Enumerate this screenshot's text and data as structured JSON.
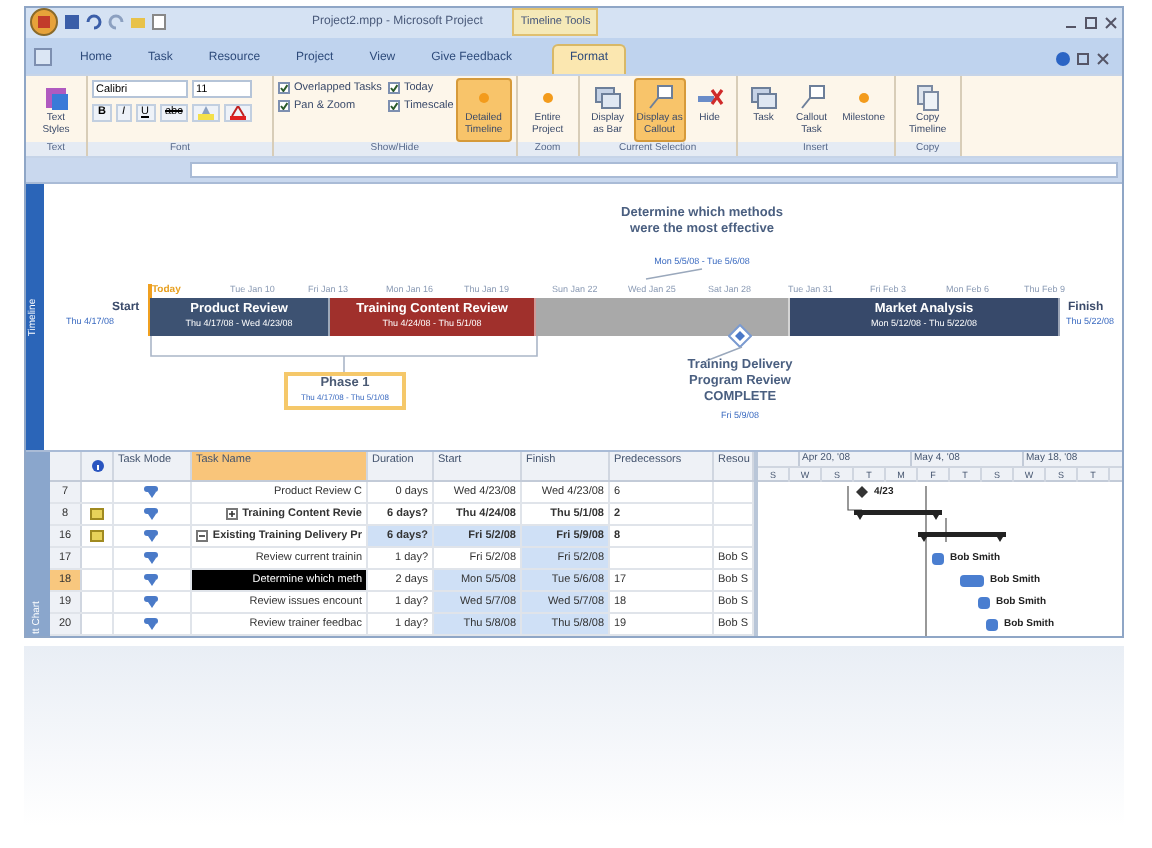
{
  "window": {
    "title": "Project2.mpp - Microsoft Project",
    "contextual_tab": "Timeline Tools"
  },
  "tabs": [
    {
      "label": "Home",
      "selected": false
    },
    {
      "label": "Task",
      "selected": false
    },
    {
      "label": "Resource",
      "selected": false
    },
    {
      "label": "Project",
      "selected": false
    },
    {
      "label": "View",
      "selected": false
    },
    {
      "label": "Give Feedback",
      "selected": false
    },
    {
      "label": "Format",
      "selected": true
    }
  ],
  "ribbon": [
    {
      "label": "Text",
      "items": [
        {
          "kind": "big",
          "label": "Text Styles",
          "selected": false
        }
      ]
    },
    {
      "label": "Font",
      "items": [
        {
          "kind": "font",
          "font": "Calibri",
          "size": "11",
          "styles": [
            "B",
            "I",
            "U",
            "abc"
          ]
        }
      ]
    },
    {
      "label": "Show/Hide",
      "items": [
        {
          "kind": "checks",
          "checks": [
            {
              "label": "Overlapped Tasks",
              "checked": true
            },
            {
              "label": "Today",
              "checked": true
            },
            {
              "label": "Pan & Zoom",
              "checked": true
            },
            {
              "label": "Timescale",
              "checked": true
            }
          ]
        },
        {
          "kind": "big",
          "label": "Detailed Timeline",
          "selected": true
        }
      ]
    },
    {
      "label": "Zoom",
      "items": [
        {
          "kind": "big",
          "label": "Entire Project",
          "selected": false
        }
      ]
    },
    {
      "label": "Current Selection",
      "items": [
        {
          "kind": "big",
          "label": "Display as Bar",
          "selected": false
        },
        {
          "kind": "big",
          "label": "Display as Callout",
          "selected": true
        },
        {
          "kind": "big",
          "label": "Hide",
          "selected": false
        }
      ]
    },
    {
      "label": "Insert",
      "items": [
        {
          "kind": "big",
          "label": "Task",
          "selected": false
        },
        {
          "kind": "big",
          "label": "Callout Task",
          "selected": false
        },
        {
          "kind": "big",
          "label": "Milestone",
          "selected": false
        }
      ]
    },
    {
      "label": "Copy",
      "items": [
        {
          "kind": "big",
          "label": "Copy Timeline",
          "selected": false
        }
      ]
    }
  ],
  "timeline": {
    "side_label": "Timeline",
    "today": "Today",
    "start": {
      "label": "Start",
      "date": "Thu 4/17/08"
    },
    "finish": {
      "label": "Finish",
      "date": "Thu 5/22/08"
    },
    "ticks": [
      "Tue Jan 10",
      "Fri Jan 13",
      "Mon Jan 16",
      "Thu Jan 19",
      "Sun Jan 22",
      "Wed Jan 25",
      "Sat Jan 28",
      "Tue Jan 31",
      "Fri Feb 3",
      "Mon Feb 6",
      "Thu Feb 9"
    ],
    "bars": [
      {
        "name": "Product Review",
        "dates": "Thu 4/17/08 - Wed 4/23/08",
        "color": "#3d5272"
      },
      {
        "name": "Training Content Review",
        "dates": "Thu 4/24/08 - Thu 5/1/08",
        "color": "#a0302c"
      },
      {
        "color": "#a9a9a9"
      },
      {
        "name": "Market Analysis",
        "dates": "Mon 5/12/08 - Thu 5/22/08",
        "color": "#37496a"
      }
    ],
    "phase": {
      "title": "Phase 1",
      "dates": "Thu 4/17/08 - Thu 5/1/08"
    },
    "callouts": [
      {
        "title": "Determine which methods were the most effective",
        "dates": "Mon 5/5/08 - Tue 5/6/08"
      }
    ],
    "milestone": {
      "title": "Training Delivery Program Review COMPLETE",
      "date": "Fri 5/9/08"
    }
  },
  "table": {
    "side_label": "tt Chart",
    "columns": [
      "Task Mode",
      "Task Name",
      "Duration",
      "Start",
      "Finish",
      "Predecessors",
      "Resou"
    ],
    "rows": [
      {
        "id": "7",
        "kind": "task",
        "note": false,
        "selected": false,
        "name": "Product Review C",
        "duration": "0 days",
        "start": "Wed 4/23/08",
        "finish": "Wed 4/23/08",
        "predecessors": "6",
        "resource_names": null,
        "gantt_label": "4/23"
      },
      {
        "id": "8",
        "kind": "summary",
        "expanded": false,
        "note": true,
        "selected": false,
        "name": "Training Content Revie",
        "duration": "6 days?",
        "start": "Thu 4/24/08",
        "finish": "Thu 5/1/08",
        "predecessors": "2",
        "resource_names": null,
        "gantt_label": null
      },
      {
        "id": "16",
        "kind": "summary",
        "expanded": true,
        "note": true,
        "selected": false,
        "name": "Existing Training Delivery Pr",
        "duration": "6 days?",
        "start": "Fri 5/2/08",
        "finish": "Fri 5/9/08",
        "predecessors": "8",
        "resource_names": null,
        "gantt_label": null
      },
      {
        "id": "17",
        "kind": "task",
        "note": false,
        "selected": false,
        "name": "Review current trainin",
        "duration": "1 day?",
        "start": "Fri 5/2/08",
        "finish": "Fri 5/2/08",
        "predecessors": null,
        "resource_names": "Bob S",
        "gantt_label": "Bob Smith"
      },
      {
        "id": "18",
        "kind": "task",
        "note": false,
        "selected": true,
        "name": "Determine which meth",
        "duration": "2 days",
        "start": "Mon 5/5/08",
        "finish": "Tue 5/6/08",
        "predecessors": "17",
        "resource_names": "Bob S",
        "gantt_label": "Bob Smith"
      },
      {
        "id": "19",
        "kind": "task",
        "note": false,
        "selected": false,
        "name": "Review issues encount",
        "duration": "1 day?",
        "start": "Wed 5/7/08",
        "finish": "Wed 5/7/08",
        "predecessors": "18",
        "resource_names": "Bob S",
        "gantt_label": "Bob Smith"
      },
      {
        "id": "20",
        "kind": "task",
        "note": false,
        "selected": false,
        "name": "Review trainer feedbac",
        "duration": "1 day?",
        "start": "Thu 5/8/08",
        "finish": "Thu 5/8/08",
        "predecessors": "19",
        "resource_names": "Bob S",
        "gantt_label": "Bob Smith"
      }
    ],
    "gantt": {
      "months": [
        "Apr 20, '08",
        "May 4, '08",
        "May 18, '08"
      ],
      "days": [
        "S",
        "W",
        "S",
        "T",
        "M",
        "F",
        "T",
        "S",
        "W",
        "S",
        "T"
      ]
    }
  }
}
